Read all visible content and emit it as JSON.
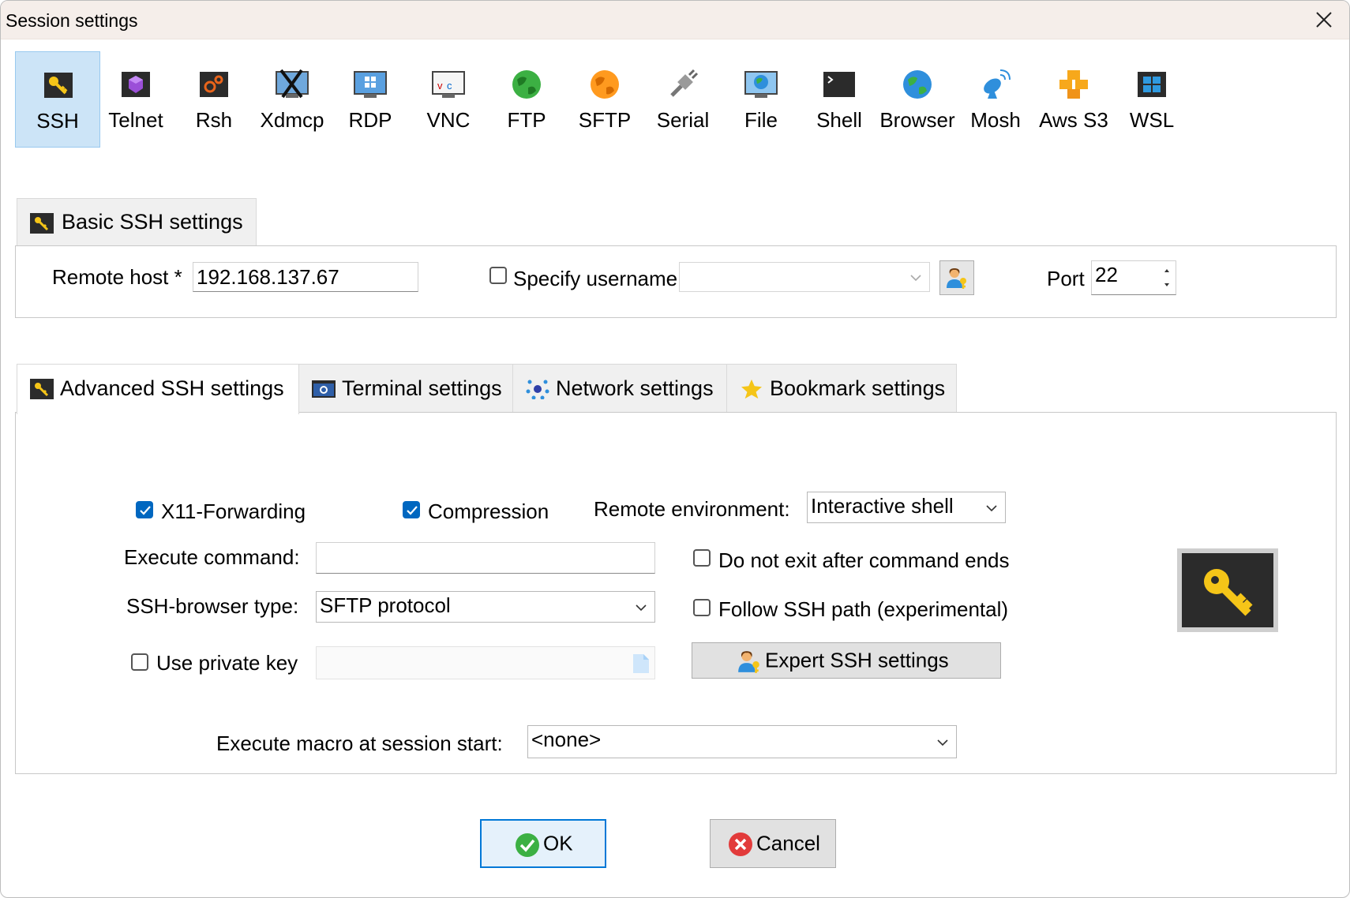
{
  "window": {
    "title": "Session settings"
  },
  "session_types": [
    {
      "label": "SSH",
      "icon": "ssh-key-icon",
      "selected": true
    },
    {
      "label": "Telnet",
      "icon": "telnet-icon"
    },
    {
      "label": "Rsh",
      "icon": "rsh-icon"
    },
    {
      "label": "Xdmcp",
      "icon": "xdmcp-icon"
    },
    {
      "label": "RDP",
      "icon": "rdp-icon"
    },
    {
      "label": "VNC",
      "icon": "vnc-icon"
    },
    {
      "label": "FTP",
      "icon": "ftp-globe-icon"
    },
    {
      "label": "SFTP",
      "icon": "sftp-globe-icon"
    },
    {
      "label": "Serial",
      "icon": "serial-plug-icon"
    },
    {
      "label": "File",
      "icon": "file-monitor-icon"
    },
    {
      "label": "Shell",
      "icon": "shell-terminal-icon"
    },
    {
      "label": "Browser",
      "icon": "browser-globe-icon"
    },
    {
      "label": "Mosh",
      "icon": "mosh-satellite-icon"
    },
    {
      "label": "Aws S3",
      "icon": "aws-s3-icon"
    },
    {
      "label": "WSL",
      "icon": "wsl-windows-icon"
    }
  ],
  "basic": {
    "tab_label": "Basic SSH settings",
    "remote_host_label": "Remote host *",
    "remote_host_value": "192.168.137.67",
    "specify_username_label": "Specify username",
    "specify_username_checked": false,
    "username_value": "",
    "port_label": "Port",
    "port_value": "22"
  },
  "tabs": [
    {
      "label": "Advanced SSH settings",
      "active": true
    },
    {
      "label": "Terminal settings"
    },
    {
      "label": "Network settings"
    },
    {
      "label": "Bookmark settings"
    }
  ],
  "advanced": {
    "x11_label": "X11-Forwarding",
    "x11_checked": true,
    "compression_label": "Compression",
    "compression_checked": true,
    "remote_env_label": "Remote environment:",
    "remote_env_value": "Interactive shell",
    "exec_cmd_label": "Execute command:",
    "exec_cmd_value": "",
    "no_exit_label": "Do not exit after command ends",
    "no_exit_checked": false,
    "browser_type_label": "SSH-browser type:",
    "browser_type_value": "SFTP protocol",
    "follow_path_label": "Follow SSH path (experimental)",
    "follow_path_checked": false,
    "private_key_label": "Use private key",
    "private_key_checked": false,
    "private_key_value": "",
    "expert_button": "Expert SSH settings",
    "macro_label": "Execute macro at session start:",
    "macro_value": "<none>"
  },
  "footer": {
    "ok": "OK",
    "cancel": "Cancel"
  },
  "colors": {
    "accent": "#0067c0",
    "selected_bg": "#cce4f7",
    "title_bg": "#f5eeea"
  }
}
